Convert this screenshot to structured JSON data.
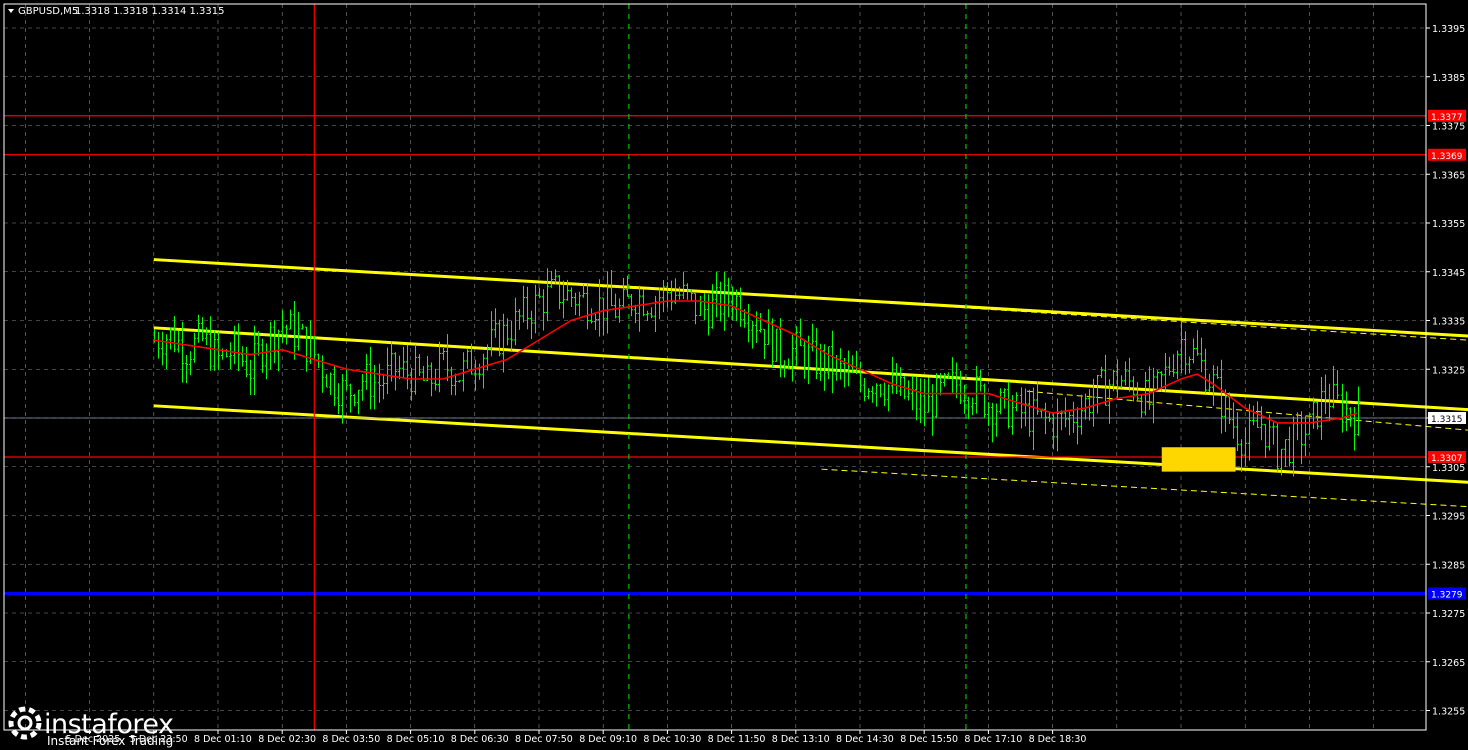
{
  "header": {
    "symbol": "GBPUSD,M5",
    "ohlc": "1.3318 1.3318 1.3314 1.3315",
    "menu_icon": "triangle-down-icon"
  },
  "watermark": {
    "brand": "instaforex",
    "tagline": "Instant Forex Trading",
    "logo_icon": "gear-icon"
  },
  "colors": {
    "background": "#000000",
    "candles": "#00ff00",
    "moving_average": "#ff0000",
    "channel": "#ffff00",
    "level_red": "#ff0000",
    "level_blue": "#0000ff",
    "grid": "#c0c0c0",
    "target_box": "#ffd700"
  },
  "chart_data": {
    "type": "line",
    "title": "GBPUSD,M5",
    "ohlc_label": "1.3318 1.3318 1.3314 1.3315",
    "ylim": [
      1.325,
      1.34
    ],
    "yticks": [
      "1.3395",
      "1.3385",
      "1.3375",
      "1.3365",
      "1.3355",
      "1.3345",
      "1.3335",
      "1.3325",
      "1.3315",
      "1.3305",
      "1.3295",
      "1.3285",
      "1.3275",
      "1.3265",
      "1.3255"
    ],
    "x_tick_labels": [
      "5 Dec 2025",
      "5 Dec 23:50",
      "8 Dec 01:10",
      "8 Dec 02:30",
      "8 Dec 03:50",
      "8 Dec 05:10",
      "8 Dec 06:30",
      "8 Dec 07:50",
      "8 Dec 09:10",
      "8 Dec 10:30",
      "8 Dec 11:50",
      "8 Dec 13:10",
      "8 Dec 14:30",
      "8 Dec 15:50",
      "8 Dec 17:10",
      "8 Dec 18:30"
    ],
    "x_axis_ticks": 16,
    "current_price": "1.3315",
    "levels": [
      {
        "price": "1.3377",
        "color": "#ff0000"
      },
      {
        "price": "1.3369",
        "color": "#ff0000"
      },
      {
        "price": "1.3307",
        "color": "#ff0000"
      },
      {
        "price": "1.3279",
        "color": "#0000ff"
      }
    ],
    "vertical_markers": [
      {
        "at_tick": 1.5,
        "style": "solid",
        "color": "#ff0000"
      },
      {
        "at_tick": 6.4,
        "style": "dashed",
        "color": "#00c000"
      },
      {
        "at_tick": 11.65,
        "style": "dashed",
        "color": "#00c000"
      },
      {
        "at_tick": 20.1,
        "style": "solid",
        "color": "#ff0000"
      }
    ],
    "channel_lines": [
      {
        "name": "upper",
        "from": {
          "tick": -1.0,
          "price": 1.33475
        },
        "to": {
          "tick": 21.2,
          "price": 1.33305
        },
        "style": "solid"
      },
      {
        "name": "middle",
        "from": {
          "tick": -1.0,
          "price": 1.33335
        },
        "to": {
          "tick": 21.2,
          "price": 1.33153
        },
        "style": "solid"
      },
      {
        "name": "lower",
        "from": {
          "tick": -1.0,
          "price": 1.33175
        },
        "to": {
          "tick": 21.2,
          "price": 1.33005
        },
        "style": "solid"
      },
      {
        "name": "upper-ext",
        "from": {
          "tick": 9.4,
          "price": 1.33395
        },
        "to": {
          "tick": 21.2,
          "price": 1.33295
        },
        "style": "dashed"
      },
      {
        "name": "middle-ext",
        "from": {
          "tick": 12.6,
          "price": 1.33205
        },
        "to": {
          "tick": 21.2,
          "price": 1.33105
        },
        "style": "dashed"
      },
      {
        "name": "lower-ext",
        "from": {
          "tick": 9.4,
          "price": 1.33045
        },
        "to": {
          "tick": 21.2,
          "price": 1.32955
        },
        "style": "dashed"
      }
    ],
    "target_zone": {
      "x_ticks": [
        14.7,
        15.85
      ],
      "y_prices": [
        1.3304,
        1.3309
      ],
      "color": "#ffd700"
    },
    "price_path": [
      [
        -1.0,
        1.3331
      ],
      [
        -0.75,
        1.3332
      ],
      [
        -0.5,
        1.3329
      ],
      [
        -0.25,
        1.3331
      ],
      [
        0,
        1.3327
      ],
      [
        0.25,
        1.3329
      ],
      [
        0.5,
        1.3325
      ],
      [
        0.75,
        1.3331
      ],
      [
        1.0,
        1.3334
      ],
      [
        1.25,
        1.3332
      ],
      [
        1.5,
        1.3328
      ],
      [
        1.75,
        1.3323
      ],
      [
        2.0,
        1.332
      ],
      [
        2.25,
        1.3323
      ],
      [
        2.5,
        1.3322
      ],
      [
        2.75,
        1.3325
      ],
      [
        3.0,
        1.3324
      ],
      [
        3.25,
        1.3322
      ],
      [
        3.5,
        1.3326
      ],
      [
        3.75,
        1.3324
      ],
      [
        4.0,
        1.3327
      ],
      [
        4.25,
        1.333
      ],
      [
        4.5,
        1.3333
      ],
      [
        4.75,
        1.3336
      ],
      [
        5.0,
        1.3339
      ],
      [
        5.25,
        1.3341
      ],
      [
        5.5,
        1.334
      ],
      [
        5.75,
        1.3339
      ],
      [
        6.0,
        1.3338
      ],
      [
        6.25,
        1.3337
      ],
      [
        6.5,
        1.334
      ],
      [
        6.75,
        1.3339
      ],
      [
        7.0,
        1.3341
      ],
      [
        7.25,
        1.334
      ],
      [
        7.5,
        1.3337
      ],
      [
        7.75,
        1.3338
      ],
      [
        8.0,
        1.334
      ],
      [
        8.25,
        1.3337
      ],
      [
        8.5,
        1.3333
      ],
      [
        8.75,
        1.3328
      ],
      [
        9.0,
        1.3329
      ],
      [
        9.25,
        1.3327
      ],
      [
        9.5,
        1.3326
      ],
      [
        9.75,
        1.3324
      ],
      [
        10.0,
        1.3322
      ],
      [
        10.25,
        1.3323
      ],
      [
        10.5,
        1.3321
      ],
      [
        10.75,
        1.3319
      ],
      [
        11.0,
        1.3317
      ],
      [
        11.25,
        1.332
      ],
      [
        11.5,
        1.3322
      ],
      [
        11.75,
        1.3321
      ],
      [
        12.0,
        1.3318
      ],
      [
        12.25,
        1.3317
      ],
      [
        12.5,
        1.3316
      ],
      [
        12.75,
        1.3315
      ],
      [
        13.0,
        1.3314
      ],
      [
        13.25,
        1.3315
      ],
      [
        13.5,
        1.3318
      ],
      [
        13.75,
        1.3321
      ],
      [
        14.0,
        1.3323
      ],
      [
        14.25,
        1.3322
      ],
      [
        14.5,
        1.3318
      ],
      [
        14.75,
        1.3324
      ],
      [
        15.0,
        1.3331
      ],
      [
        15.25,
        1.3327
      ],
      [
        15.5,
        1.3322
      ],
      [
        15.75,
        1.3315
      ],
      [
        16.0,
        1.331
      ],
      [
        16.25,
        1.3314
      ],
      [
        16.5,
        1.3308
      ],
      [
        16.75,
        1.331
      ],
      [
        17.0,
        1.3313
      ],
      [
        17.25,
        1.332
      ],
      [
        17.5,
        1.3317
      ],
      [
        17.75,
        1.3315
      ]
    ],
    "moving_average_path": [
      [
        -1.0,
        1.3331
      ],
      [
        -0.5,
        1.333
      ],
      [
        0,
        1.3329
      ],
      [
        0.5,
        1.3328
      ],
      [
        1.0,
        1.3329
      ],
      [
        1.5,
        1.3327
      ],
      [
        2.0,
        1.3325
      ],
      [
        2.5,
        1.3324
      ],
      [
        3.0,
        1.3323
      ],
      [
        3.5,
        1.3323
      ],
      [
        4.0,
        1.3325
      ],
      [
        4.5,
        1.3327
      ],
      [
        5.0,
        1.3331
      ],
      [
        5.5,
        1.3335
      ],
      [
        6.0,
        1.3337
      ],
      [
        6.5,
        1.3338
      ],
      [
        7.0,
        1.3339
      ],
      [
        7.5,
        1.3339
      ],
      [
        8.0,
        1.3338
      ],
      [
        8.5,
        1.3335
      ],
      [
        9.0,
        1.3332
      ],
      [
        9.5,
        1.3328
      ],
      [
        10.0,
        1.3325
      ],
      [
        10.5,
        1.3322
      ],
      [
        11.0,
        1.332
      ],
      [
        11.5,
        1.332
      ],
      [
        12.0,
        1.332
      ],
      [
        12.5,
        1.3318
      ],
      [
        13.0,
        1.3316
      ],
      [
        13.5,
        1.3317
      ],
      [
        14.0,
        1.3319
      ],
      [
        14.5,
        1.332
      ],
      [
        15.0,
        1.3323
      ],
      [
        15.25,
        1.3324
      ],
      [
        15.5,
        1.3322
      ],
      [
        16.0,
        1.3317
      ],
      [
        16.5,
        1.3314
      ],
      [
        17.0,
        1.3314
      ],
      [
        17.5,
        1.3315
      ],
      [
        17.75,
        1.3316
      ]
    ]
  }
}
